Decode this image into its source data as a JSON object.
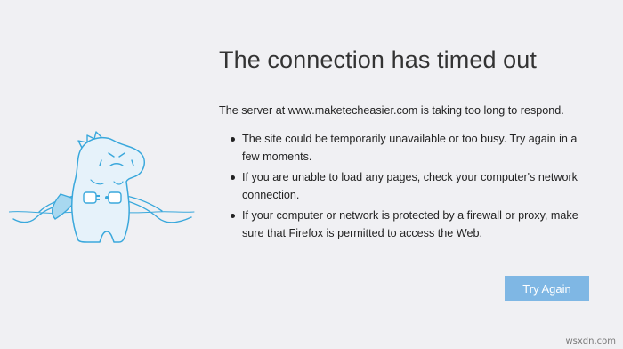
{
  "error": {
    "title": "The connection has timed out",
    "description": "The server at www.maketecheasier.com is taking too long to respond.",
    "suggestions": [
      "The site could be temporarily unavailable or too busy. Try again in a few moments.",
      "If you are unable to load any pages, check your computer's network connection.",
      "If your computer or network is protected by a firewall or proxy, make sure that Firefox is permitted to access the Web."
    ]
  },
  "actions": {
    "try_again_label": "Try Again"
  },
  "illustration": {
    "icon": "dinosaur-unplugged-cable-illustration",
    "colors": {
      "outline": "#3aa8dc",
      "fill": "#e6f2fa",
      "cape": "#a8d8f0"
    }
  },
  "watermark": {
    "text": "wsxdn.com"
  },
  "colors": {
    "background": "#f0f0f3",
    "button": "#7fb7e4",
    "text": "#222222"
  }
}
